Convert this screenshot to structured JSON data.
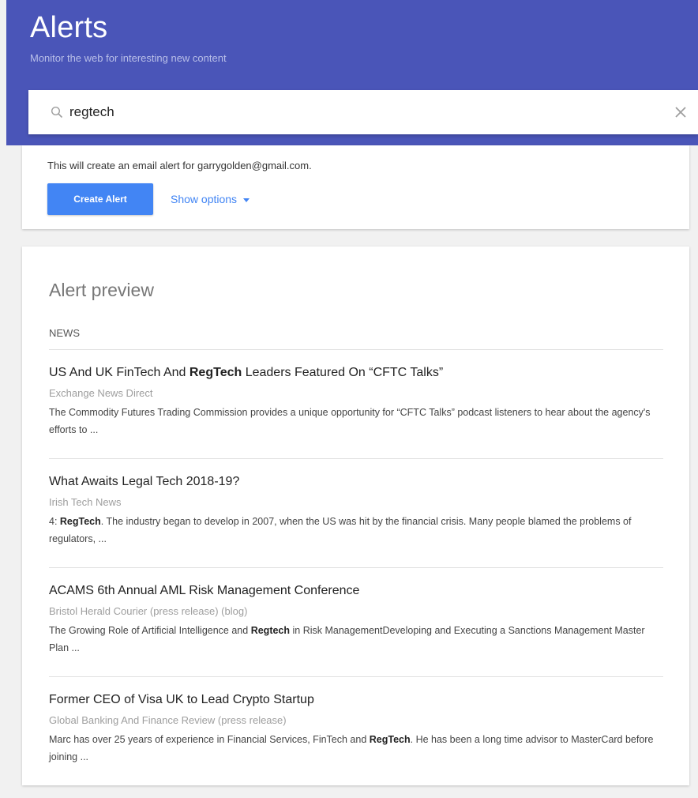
{
  "header": {
    "title": "Alerts",
    "subtitle": "Monitor the web for interesting new content"
  },
  "search": {
    "query": "regtech",
    "search_icon": "search-icon",
    "clear_icon": "close-icon"
  },
  "create": {
    "email_note": "This will create an email alert for garrygolden@gmail.com.",
    "create_button": "Create Alert",
    "show_options": "Show options"
  },
  "preview": {
    "title": "Alert preview",
    "section": "NEWS",
    "items": [
      {
        "title_parts": [
          "US And UK FinTech And ",
          "RegTech",
          " Leaders Featured On “CFTC Talks”"
        ],
        "source": "Exchange News Direct",
        "snippet_parts": [
          "The Commodity Futures Trading Commission provides a unique opportunity for “CFTC Talks” podcast listeners to hear about the agency's efforts to ..."
        ]
      },
      {
        "title_parts": [
          "What Awaits Legal Tech 2018-19?"
        ],
        "source": "Irish Tech News",
        "snippet_parts": [
          "4: ",
          "RegTech",
          ". The industry began to develop in 2007, when the US was hit by the financial crisis. Many people blamed the problems of regulators, ..."
        ]
      },
      {
        "title_parts": [
          "ACAMS 6th Annual AML Risk Management Conference"
        ],
        "source": "Bristol Herald Courier (press release) (blog)",
        "snippet_parts": [
          "The Growing Role of Artificial Intelligence and ",
          "Regtech",
          " in Risk ManagementDeveloping and Executing a Sanctions Management Master Plan ..."
        ]
      },
      {
        "title_parts": [
          "Former CEO of Visa UK to Lead Crypto Startup"
        ],
        "source": "Global Banking And Finance Review (press release)",
        "snippet_parts": [
          "Marc has over 25 years of experience in Financial Services, FinTech and ",
          "RegTech",
          ". He has been a long time advisor to MasterCard before joining ..."
        ]
      }
    ]
  },
  "colors": {
    "header_bg": "#4a55b8",
    "accent": "#4285f4"
  }
}
